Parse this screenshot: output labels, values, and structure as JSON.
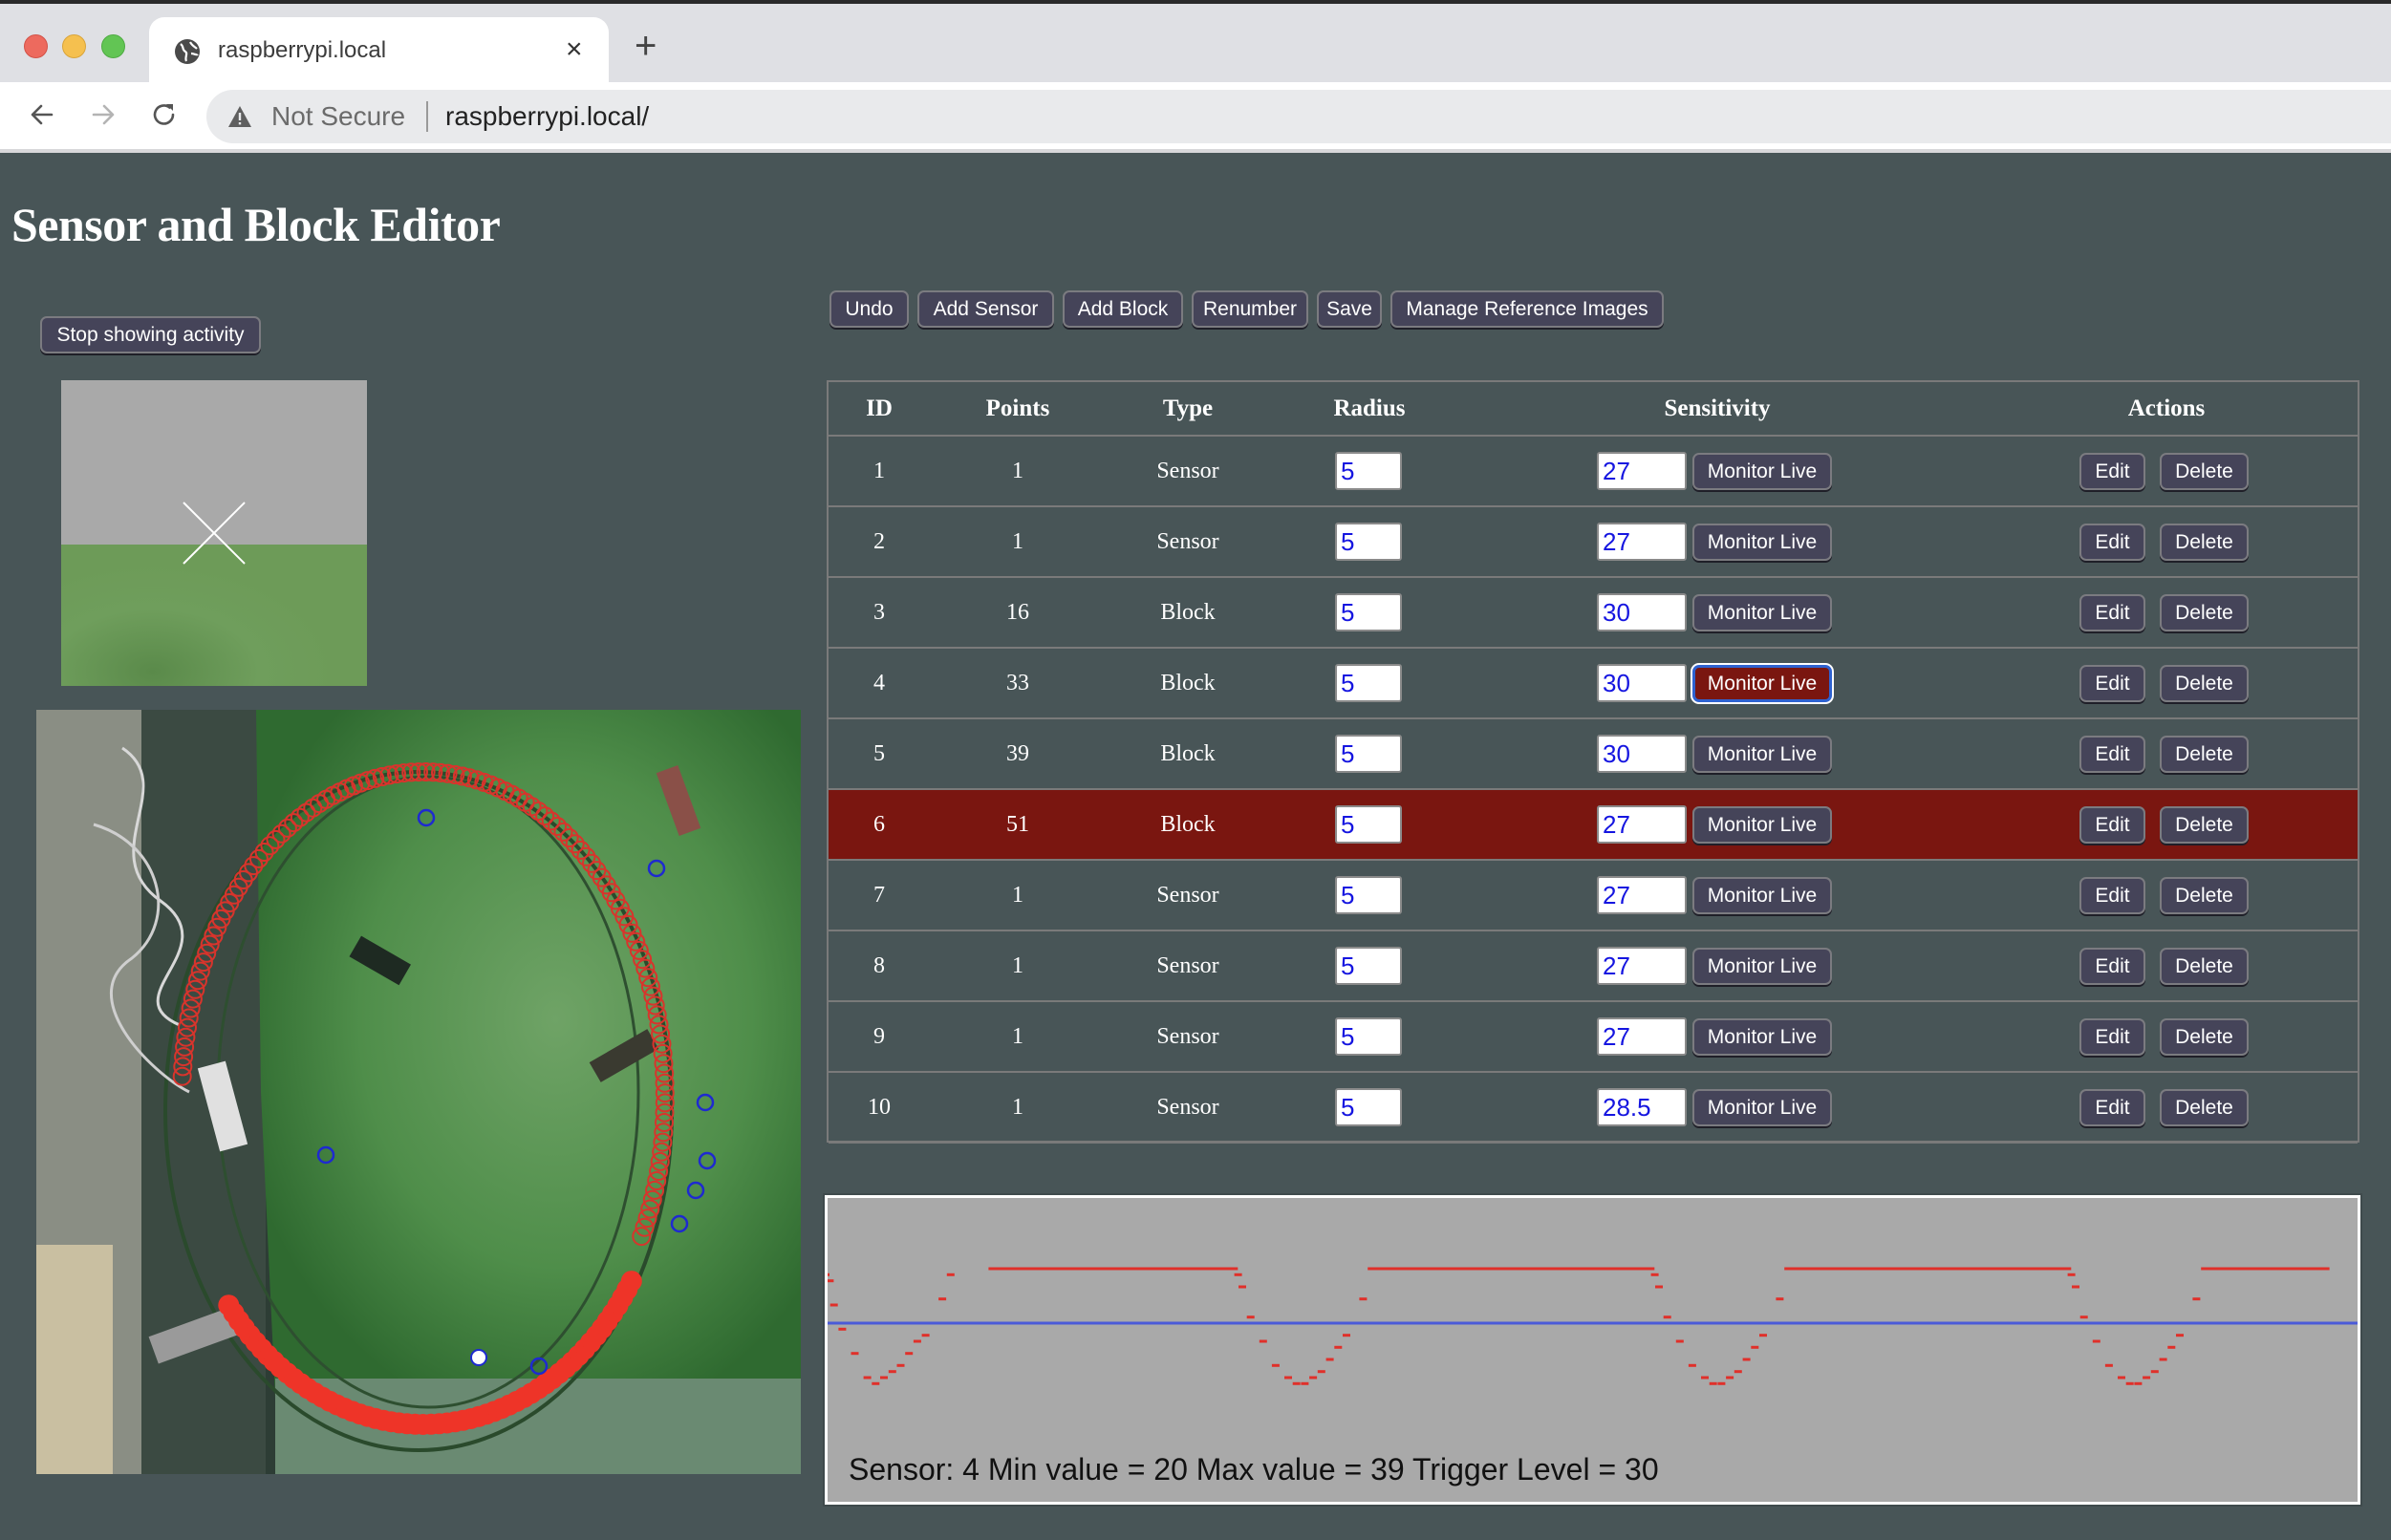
{
  "browser": {
    "tab_title": "raspberrypi.local",
    "tab_close": "×",
    "new_tab": "+",
    "security_label": "Not Secure",
    "url": "raspberrypi.local/",
    "icons": [
      "back-arrow-icon",
      "forward-arrow-icon",
      "reload-icon",
      "warning-icon",
      "globe-icon"
    ]
  },
  "page": {
    "title": "Sensor and Block Editor",
    "stop_activity_label": "Stop showing activity"
  },
  "toolbar": {
    "buttons": [
      {
        "id": "undo",
        "label": "Undo"
      },
      {
        "id": "add-sensor",
        "label": "Add Sensor"
      },
      {
        "id": "add-block",
        "label": "Add Block"
      },
      {
        "id": "renumber",
        "label": "Renumber"
      },
      {
        "id": "save",
        "label": "Save"
      },
      {
        "id": "manage-reference-images",
        "label": "Manage Reference Images"
      }
    ]
  },
  "table": {
    "columns": [
      "ID",
      "Points",
      "Type",
      "Radius",
      "Sensitivity",
      "Actions"
    ],
    "monitor_label": "Monitor Live",
    "edit_label": "Edit",
    "delete_label": "Delete",
    "highlight_color": "#7a1610",
    "rows": [
      {
        "id": "1",
        "points": "1",
        "type": "Sensor",
        "radius": "5",
        "sensitivity": "27",
        "monitoring": false,
        "highlighted": false
      },
      {
        "id": "2",
        "points": "1",
        "type": "Sensor",
        "radius": "5",
        "sensitivity": "27",
        "monitoring": false,
        "highlighted": false
      },
      {
        "id": "3",
        "points": "16",
        "type": "Block",
        "radius": "5",
        "sensitivity": "30",
        "monitoring": false,
        "highlighted": false
      },
      {
        "id": "4",
        "points": "33",
        "type": "Block",
        "radius": "5",
        "sensitivity": "30",
        "monitoring": true,
        "highlighted": false
      },
      {
        "id": "5",
        "points": "39",
        "type": "Block",
        "radius": "5",
        "sensitivity": "30",
        "monitoring": false,
        "highlighted": false
      },
      {
        "id": "6",
        "points": "51",
        "type": "Block",
        "radius": "5",
        "sensitivity": "27",
        "monitoring": false,
        "highlighted": true
      },
      {
        "id": "7",
        "points": "1",
        "type": "Sensor",
        "radius": "5",
        "sensitivity": "27",
        "monitoring": false,
        "highlighted": false
      },
      {
        "id": "8",
        "points": "1",
        "type": "Sensor",
        "radius": "5",
        "sensitivity": "27",
        "monitoring": false,
        "highlighted": false
      },
      {
        "id": "9",
        "points": "1",
        "type": "Sensor",
        "radius": "5",
        "sensitivity": "27",
        "monitoring": false,
        "highlighted": false
      },
      {
        "id": "10",
        "points": "1",
        "type": "Sensor",
        "radius": "5",
        "sensitivity": "28.5",
        "monitoring": false,
        "highlighted": false
      }
    ]
  },
  "monitor": {
    "caption": "Sensor: 4 Min value = 20 Max value = 39 Trigger Level = 30",
    "sensor_id": 4,
    "min_value": 20,
    "max_value": 39,
    "trigger_level": 30,
    "signal_color": "#e0302a",
    "trigger_color": "#4a5ad8"
  },
  "chart_data": {
    "type": "line",
    "title": "",
    "xlabel": "",
    "ylabel": "",
    "ylim": [
      15,
      45
    ],
    "series": [
      {
        "name": "sensor-4-signal",
        "description": "periodic square-ish wave: plateau at max, dips to min",
        "x": [
          0,
          1,
          2,
          4,
          7,
          10,
          12,
          14,
          16,
          18,
          20,
          22,
          24,
          26,
          28,
          30,
          40,
          60,
          80,
          98,
          99,
          100,
          102,
          105,
          108,
          111,
          113,
          115,
          117,
          119,
          121,
          123,
          125,
          127,
          129,
          131,
          140,
          160,
          180,
          198,
          199,
          200,
          202,
          205,
          208,
          211,
          213,
          215,
          217,
          219,
          221,
          223,
          225,
          227,
          229,
          231,
          240,
          260,
          280,
          298,
          299,
          300,
          302,
          305,
          308,
          311,
          313,
          315,
          317,
          319,
          321,
          323,
          325,
          327,
          329,
          331,
          340,
          360
        ],
        "values": [
          38,
          37,
          33,
          29,
          25,
          21,
          20,
          21,
          22,
          23,
          25,
          27,
          28,
          30,
          34,
          38,
          39,
          39,
          39,
          39,
          38,
          36,
          31,
          27,
          23,
          21,
          20,
          20,
          21,
          22,
          24,
          26,
          28,
          30,
          34,
          39,
          39,
          39,
          39,
          39,
          38,
          36,
          31,
          27,
          23,
          21,
          20,
          20,
          21,
          22,
          24,
          26,
          28,
          30,
          34,
          39,
          39,
          39,
          39,
          39,
          38,
          36,
          31,
          27,
          23,
          21,
          20,
          20,
          21,
          22,
          24,
          26,
          28,
          30,
          34,
          39,
          39,
          39
        ]
      },
      {
        "name": "trigger-level",
        "x": [
          0,
          360
        ],
        "values": [
          30,
          30
        ]
      }
    ],
    "annotations": [
      "Sensor: 4 Min value = 20 Max value = 39 Trigger Level = 30"
    ],
    "grid": false,
    "legend": "none"
  }
}
